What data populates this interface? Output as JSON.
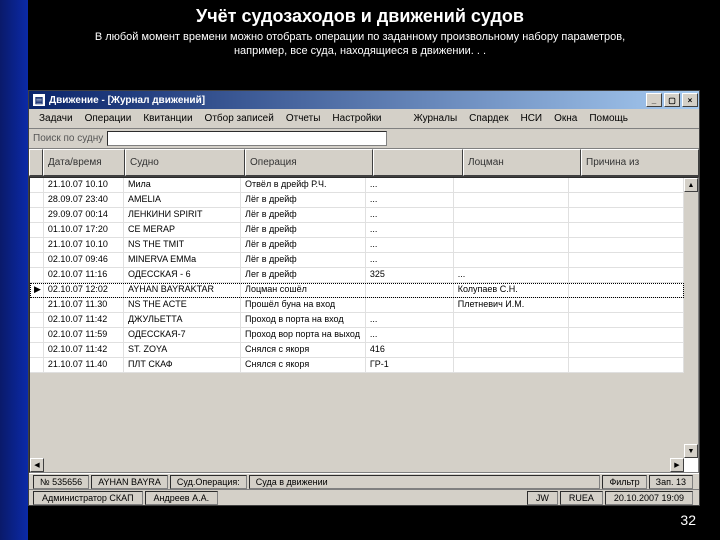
{
  "slide": {
    "title": "Учёт судозаходов и движений судов",
    "sub1": "В любой момент времени можно отобрать операции по заданному произвольному набору параметров,",
    "sub2": "например, все суда, находящиеся в движении. . .",
    "pagenum": "32"
  },
  "window": {
    "title": "Движение - [Журнал движений]",
    "btn_min": "_",
    "btn_max": "▢",
    "btn_close": "×"
  },
  "menu": [
    "Задачи",
    "Операции",
    "Квитанции",
    "Отбор записей",
    "Отчеты",
    "Настройки",
    "Журналы",
    "Спардек",
    "НСИ",
    "Окна",
    "Помощь"
  ],
  "search": {
    "label": "Поиск по судну",
    "value": ""
  },
  "columns": [
    "",
    "Дата/время",
    "Судно",
    "Операция",
    "",
    "Лоцман",
    "Причина из"
  ],
  "rows": [
    {
      "dt": "21.10.07 10.10",
      "ship": "Мила",
      "op": "Отвёл в дрейф Р.Ч.",
      "c4": "...",
      "pilot": "",
      "note": ""
    },
    {
      "dt": "28.09.07 23:40",
      "ship": "AMELIA",
      "op": "Лёг в дрейф",
      "c4": "...",
      "pilot": "",
      "note": ""
    },
    {
      "dt": "29.09.07 00:14",
      "ship": "ЛЕНКИНИ SPIRIT",
      "op": "Лёг в дрейф",
      "c4": "...",
      "pilot": "",
      "note": ""
    },
    {
      "dt": "01.10.07 17:20",
      "ship": "CE MERАР",
      "op": "Лёг в дрейф",
      "c4": "...",
      "pilot": "",
      "note": ""
    },
    {
      "dt": "21.10.07 10.10",
      "ship": "NS THE TMIT",
      "op": "Лёг в дрейф",
      "c4": "...",
      "pilot": "",
      "note": ""
    },
    {
      "dt": "02.10.07 09:46",
      "ship": "MINERVA EMMa",
      "op": "Лёг в дрейф",
      "c4": "...",
      "pilot": "",
      "note": ""
    },
    {
      "dt": "02.10.07 11:16",
      "ship": "ОДЕССКАЯ - 6",
      "op": "Лег в дрейф",
      "c4": "325",
      "pilot": "...",
      "note": ""
    },
    {
      "dt": "02.10.07 12:02",
      "ship": "AYHAN BAYRAKTAR",
      "op": "Лоцман сошёл",
      "c4": "",
      "pilot": "Колупаев С.Н.",
      "note": ""
    },
    {
      "dt": "21.10.07 11.30",
      "ship": "NS THE ACTE",
      "op": "Прошёл буна на вход",
      "c4": "",
      "pilot": "Плетневич И.М.",
      "note": ""
    },
    {
      "dt": "02.10.07 11:42",
      "ship": "ДЖУЛЬЕТТА",
      "op": "Проход в порта на вход",
      "c4": "...",
      "pilot": "",
      "note": ""
    },
    {
      "dt": "02.10.07 11:59",
      "ship": "ОДЕССКАЯ-7",
      "op": "Проход вор порта на выход",
      "c4": "...",
      "pilot": "",
      "note": ""
    },
    {
      "dt": "02.10.07 11:42",
      "ship": "ST. ZOYA",
      "op": "Снялся с якоря",
      "c4": "416",
      "pilot": "",
      "note": ""
    },
    {
      "dt": "21.10.07 11.40",
      "ship": "ПЛТ СКАФ",
      "op": "Снялся с якоря",
      "c4": "ГР-1",
      "pilot": "",
      "note": ""
    }
  ],
  "status1": {
    "rec_no": "№ 535656",
    "ship": "AYHAN BAYRA",
    "filter_label": "Суд.Операция:",
    "filter_value": "Суда в движении",
    "filter_btn": "Фильтр",
    "count": "Зап. 13"
  },
  "status2": {
    "user": "Администратор СКАП",
    "name": "Андреев А.А.",
    "sys": "JW",
    "port": "RUEА",
    "datetime": "20.10.2007 19:09"
  }
}
